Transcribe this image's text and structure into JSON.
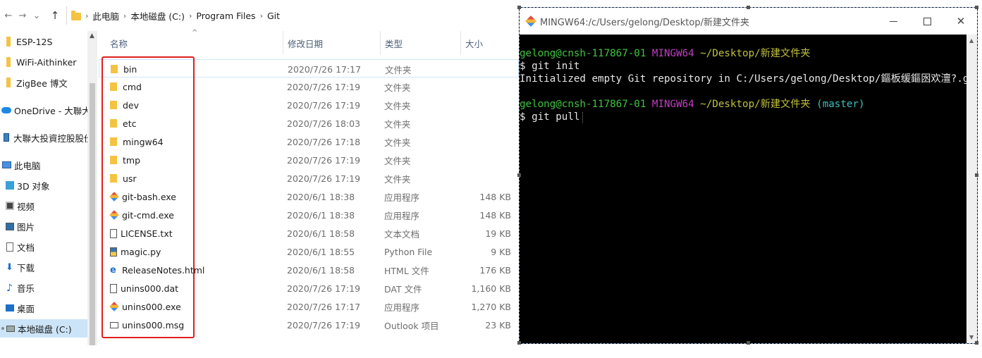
{
  "explorer": {
    "address": {
      "crumbs": [
        "此电脑",
        "本地磁盘 (C:)",
        "Program Files",
        "Git"
      ]
    },
    "sidebar": {
      "items": [
        {
          "label": "ESP-12S",
          "icon": "folder-icon"
        },
        {
          "label": "WiFi-Aithinker",
          "icon": "folder-icon"
        },
        {
          "label": "ZigBee 博文",
          "icon": "folder-icon"
        },
        {
          "label": "OneDrive - 大聯大投資",
          "icon": "cloud-icon"
        },
        {
          "label": "大聯大投資控股股份有限",
          "icon": "network-icon"
        },
        {
          "label": "此电脑",
          "icon": "computer-icon"
        },
        {
          "label": "3D 对象",
          "icon": "3d-objects-icon"
        },
        {
          "label": "视频",
          "icon": "video-icon"
        },
        {
          "label": "图片",
          "icon": "pictures-icon"
        },
        {
          "label": "文档",
          "icon": "documents-icon"
        },
        {
          "label": "下载",
          "icon": "downloads-icon"
        },
        {
          "label": "音乐",
          "icon": "music-icon"
        },
        {
          "label": "桌面",
          "icon": "desktop-icon"
        },
        {
          "label": "本地磁盘 (C:)",
          "icon": "drive-icon"
        }
      ],
      "selected": "本地磁盘 (C:)"
    },
    "columns": {
      "name": "名称",
      "date": "修改日期",
      "type": "类型",
      "size": "大小"
    },
    "files": [
      {
        "name": "bin",
        "date": "2020/7/26 17:17",
        "type": "文件夹",
        "size": "",
        "icon": "folder"
      },
      {
        "name": "cmd",
        "date": "2020/7/26 17:19",
        "type": "文件夹",
        "size": "",
        "icon": "folder"
      },
      {
        "name": "dev",
        "date": "2020/7/26 17:19",
        "type": "文件夹",
        "size": "",
        "icon": "folder"
      },
      {
        "name": "etc",
        "date": "2020/7/26 18:03",
        "type": "文件夹",
        "size": "",
        "icon": "folder"
      },
      {
        "name": "mingw64",
        "date": "2020/7/26 17:18",
        "type": "文件夹",
        "size": "",
        "icon": "folder"
      },
      {
        "name": "tmp",
        "date": "2020/7/26 17:19",
        "type": "文件夹",
        "size": "",
        "icon": "folder"
      },
      {
        "name": "usr",
        "date": "2020/7/26 17:19",
        "type": "文件夹",
        "size": "",
        "icon": "folder"
      },
      {
        "name": "git-bash.exe",
        "date": "2020/6/1 18:38",
        "type": "应用程序",
        "size": "148 KB",
        "icon": "git"
      },
      {
        "name": "git-cmd.exe",
        "date": "2020/6/1 18:38",
        "type": "应用程序",
        "size": "148 KB",
        "icon": "git"
      },
      {
        "name": "LICENSE.txt",
        "date": "2020/6/1 18:58",
        "type": "文本文档",
        "size": "19 KB",
        "icon": "txt"
      },
      {
        "name": "magic.py",
        "date": "2020/6/1 18:55",
        "type": "Python File",
        "size": "9 KB",
        "icon": "py"
      },
      {
        "name": "ReleaseNotes.html",
        "date": "2020/6/1 18:58",
        "type": "HTML 文件",
        "size": "176 KB",
        "icon": "html"
      },
      {
        "name": "unins000.dat",
        "date": "2020/7/26 17:19",
        "type": "DAT 文件",
        "size": "1,160 KB",
        "icon": "dat"
      },
      {
        "name": "unins000.exe",
        "date": "2020/7/26 17:17",
        "type": "应用程序",
        "size": "1,270 KB",
        "icon": "git"
      },
      {
        "name": "unins000.msg",
        "date": "2020/7/26 17:19",
        "type": "Outlook 项目",
        "size": "23 KB",
        "icon": "msg"
      }
    ]
  },
  "terminal": {
    "title": "MINGW64:/c/Users/gelong/Desktop/新建文件夹",
    "prompt1": {
      "user": "gelong@cnsh-117867-01",
      "env": "MINGW64",
      "path": "~/Desktop/新建文件夹",
      "branch": ""
    },
    "cmd1": "$ git init",
    "output1": "Initialized empty Git repository in C:/Users/gelong/Desktop/鏂板缓鏂囦欢澶?.git/",
    "prompt2": {
      "user": "gelong@cnsh-117867-01",
      "env": "MINGW64",
      "path": "~/Desktop/新建文件夹",
      "branch": "(master)"
    },
    "cmd2": "$ git pull",
    "colors": {
      "background": "#000000",
      "user": "#3fc43f",
      "env": "#c23fc2",
      "path": "#c0c03f",
      "branch": "#3fbfbf",
      "text": "#e8e8e8"
    }
  },
  "annotation": {
    "highlight_color": "#e02020"
  }
}
